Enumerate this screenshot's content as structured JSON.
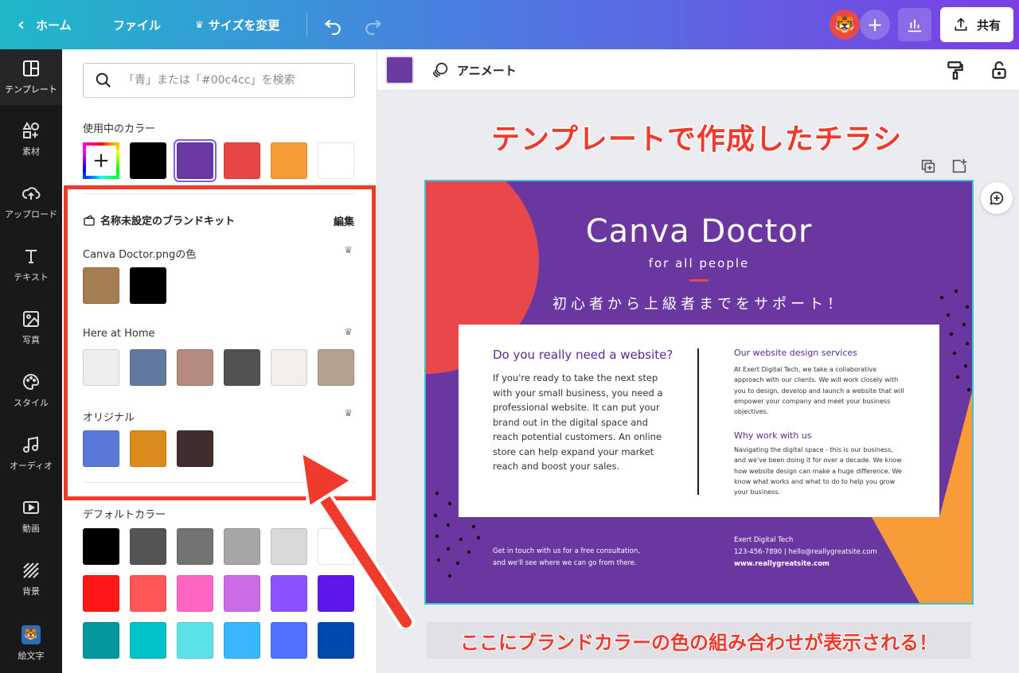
{
  "topbar": {
    "home": "ホーム",
    "file": "ファイル",
    "resize": "サイズを変更",
    "share": "共有"
  },
  "nav": [
    {
      "label": "テンプレート",
      "icon": "template-icon"
    },
    {
      "label": "素材",
      "icon": "elements-icon"
    },
    {
      "label": "アップロード",
      "icon": "upload-icon"
    },
    {
      "label": "テキスト",
      "icon": "text-icon"
    },
    {
      "label": "写真",
      "icon": "photo-icon"
    },
    {
      "label": "スタイル",
      "icon": "palette-icon"
    },
    {
      "label": "オーディオ",
      "icon": "music-icon"
    },
    {
      "label": "動画",
      "icon": "video-icon"
    },
    {
      "label": "背景",
      "icon": "background-icon"
    },
    {
      "label": "絵文字",
      "icon": "emoji-icon"
    }
  ],
  "panel": {
    "search_placeholder": "「青」または「#00c4cc」を検索",
    "in_use_title": "使用中のカラー",
    "in_use_colors": [
      "#000000",
      "#6a3aa2",
      "#e84646",
      "#f89c3a",
      "#ffffff"
    ],
    "brand_kit_title": "名称未設定のブランドキット",
    "edit": "編集",
    "palettes": [
      {
        "title": "Canva Doctor.pngの色",
        "colors": [
          "#a57d52",
          "#000000"
        ]
      },
      {
        "title": "Here at Home",
        "colors": [
          "#efedeb",
          "#637aa0",
          "#b48a7e",
          "#525252",
          "#f2efea",
          "#b5a190"
        ]
      },
      {
        "title": "オリジナル",
        "colors": [
          "#5a78d8",
          "#db8a1c",
          "#402d2d"
        ]
      }
    ],
    "default_title": "デフォルトカラー",
    "default_colors": [
      "#000000",
      "#545454",
      "#737373",
      "#a6a6a6",
      "#d9d9d9",
      "#ffffff",
      "#ff1616",
      "#ff5757",
      "#ff66c4",
      "#cb6ce6",
      "#8c52ff",
      "#5e17eb",
      "#03989e",
      "#00c2cb",
      "#5ce1e6",
      "#38b6ff",
      "#5271ff",
      "#004aad"
    ]
  },
  "context_bar": {
    "color": "#6c3aa3",
    "animate": "アニメート"
  },
  "annotation_title": "テンプレートで作成したチラシ",
  "annotation_bottom": "ここにブランドカラーの色の組み合わせが表示される！",
  "design": {
    "title": "Canva Doctor",
    "subtitle": "for all people",
    "tagline": "初心者から上級者までをサポート！",
    "card_heading": "Do you really need a website?",
    "card_body": "If you're ready to take the next step with your small business, you need a professional website.  It can put your brand out in the digital space and reach potential customers. An online store can help expand your market reach and boost your sales.",
    "services_heading": "Our website design services",
    "services_body": "At Exert Digital Tech, we take a collaborative approach with our clients. We will work closely with you to design, develop and launch a website that will empower your company and meet your business objectives.",
    "why_heading": "Why work with us",
    "why_body": "Navigating the digital space - this is our business, and we've been doing it for over a decade. We know how website design can make a huge difference. We know what works and what to do to help you grow your business.",
    "footer_left_1": "Get in touch with us for a free consultation,",
    "footer_left_2": "and we'll see where we can go from there.",
    "company": "Exert Digital Tech",
    "contact": "123-456-7890 | hello@reallygreatsite.com",
    "website": "www.reallygreatsite.com",
    "colors": {
      "purple": "#6a36a0",
      "red": "#e8484a",
      "orange": "#f89c3a"
    }
  }
}
